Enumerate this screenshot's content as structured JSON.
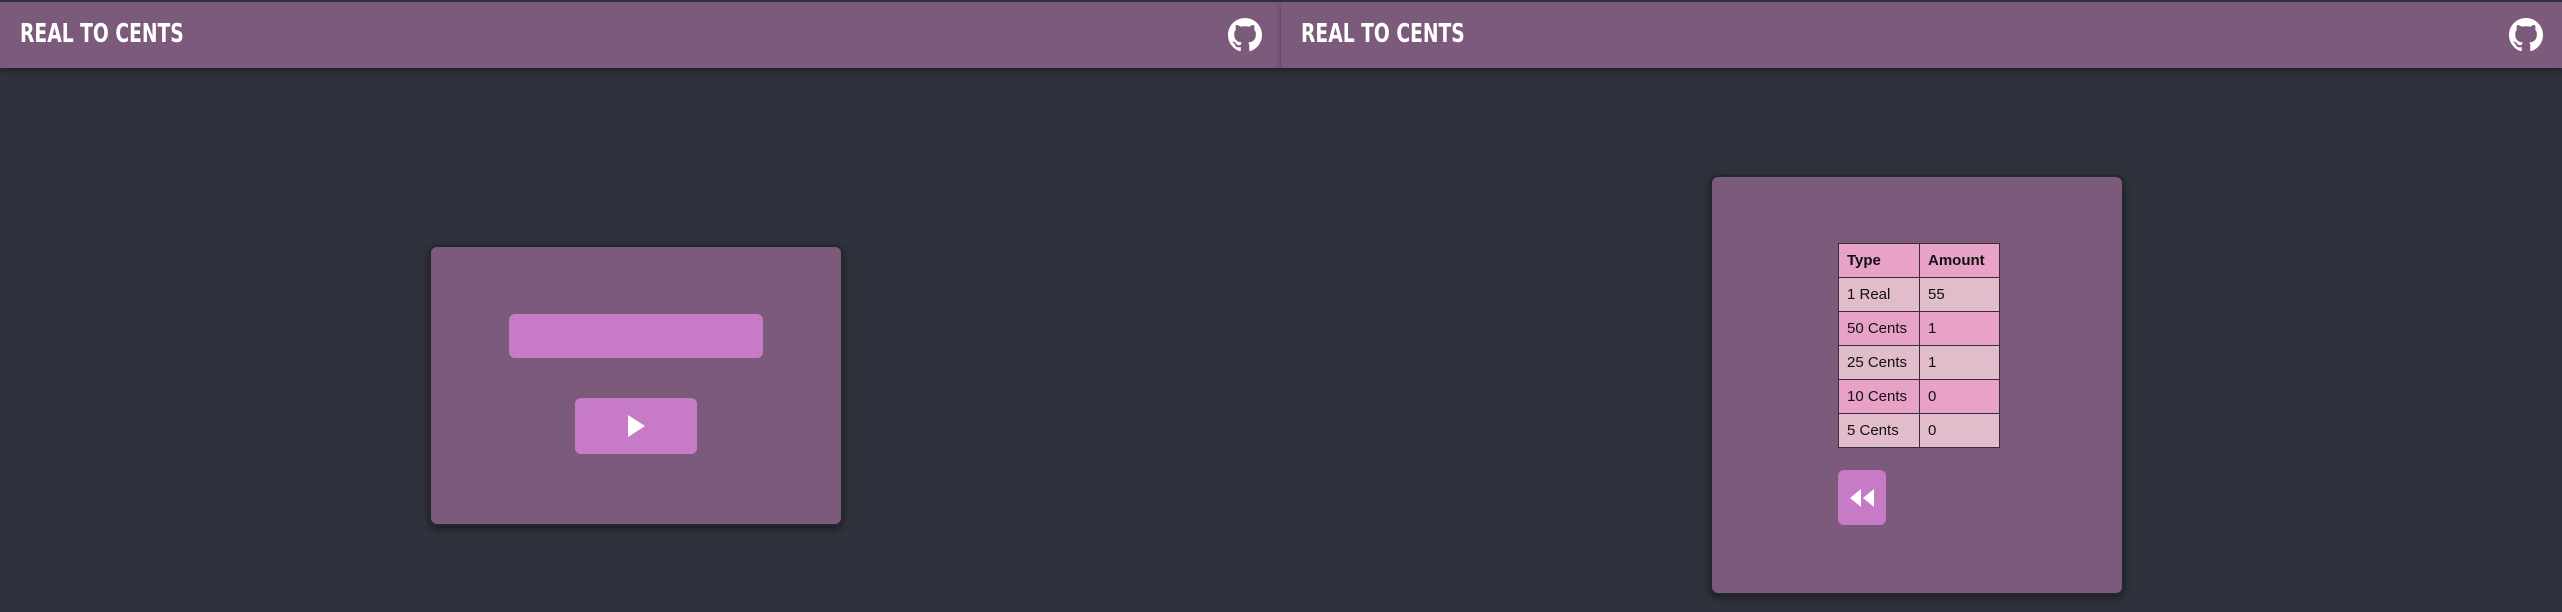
{
  "left_pane": {
    "header": {
      "title": "REAL TO CENTS",
      "icon": "github-icon"
    },
    "form": {
      "input_value": "",
      "submit_icon": "play-icon"
    }
  },
  "right_pane": {
    "header": {
      "title": "REAL TO CENTS",
      "icon": "github-icon"
    },
    "result": {
      "columns": [
        "Type",
        "Amount"
      ],
      "rows": [
        {
          "type": "1 Real",
          "amount": "55"
        },
        {
          "type": "50 Cents",
          "amount": "1"
        },
        {
          "type": "25 Cents",
          "amount": "1"
        },
        {
          "type": "10 Cents",
          "amount": "0"
        },
        {
          "type": "5 Cents",
          "amount": "0"
        }
      ],
      "back_icon": "rewind-icon"
    }
  },
  "colors": {
    "background": "#2f323c",
    "bar": "#7c5a7c",
    "accent": "#c77ac5",
    "table_header": "#e8a2c8",
    "table_row_light": "#e1bccb"
  }
}
